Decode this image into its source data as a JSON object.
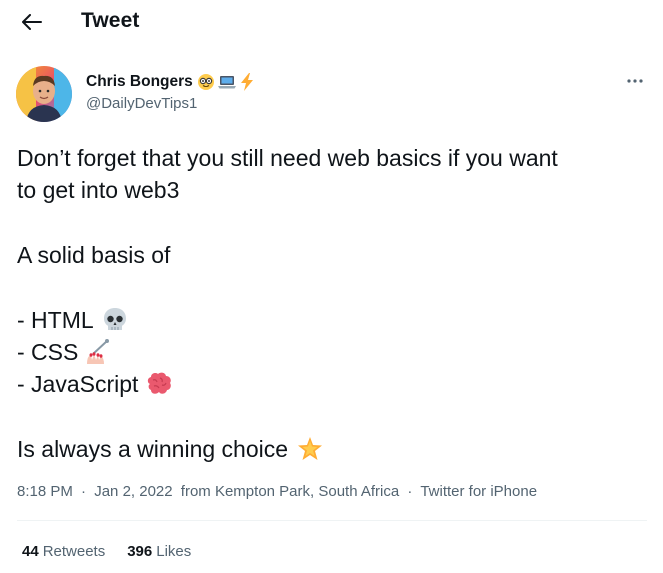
{
  "header": {
    "title": "Tweet"
  },
  "author": {
    "name": "Chris Bongers",
    "handle": "@DailyDevTips1",
    "badges": [
      "nerd-face-emoji",
      "laptop-emoji",
      "lightning-emoji"
    ]
  },
  "tweet": {
    "lines": [
      "Don’t forget that you still need web basics if you want",
      "to get into web3",
      "",
      "A solid basis of",
      "",
      "- HTML",
      "- CSS",
      "- JavaScript",
      "",
      "Is always a winning choice"
    ],
    "emojis": {
      "html": "skull-emoji",
      "css": "nail-polish-emoji",
      "javascript": "brain-emoji",
      "choice": "glowing-star-emoji"
    }
  },
  "meta": {
    "time": "8:18 PM",
    "separator": "·",
    "date": "Jan 2, 2022",
    "location": "from Kempton Park, South Africa",
    "source": "Twitter for iPhone"
  },
  "stats": {
    "retweets_count": "44",
    "retweets_label": "Retweets",
    "likes_count": "396",
    "likes_label": "Likes"
  },
  "colors": {
    "text": "#0f1419",
    "secondary": "#536471",
    "divider": "#eff3f4"
  }
}
